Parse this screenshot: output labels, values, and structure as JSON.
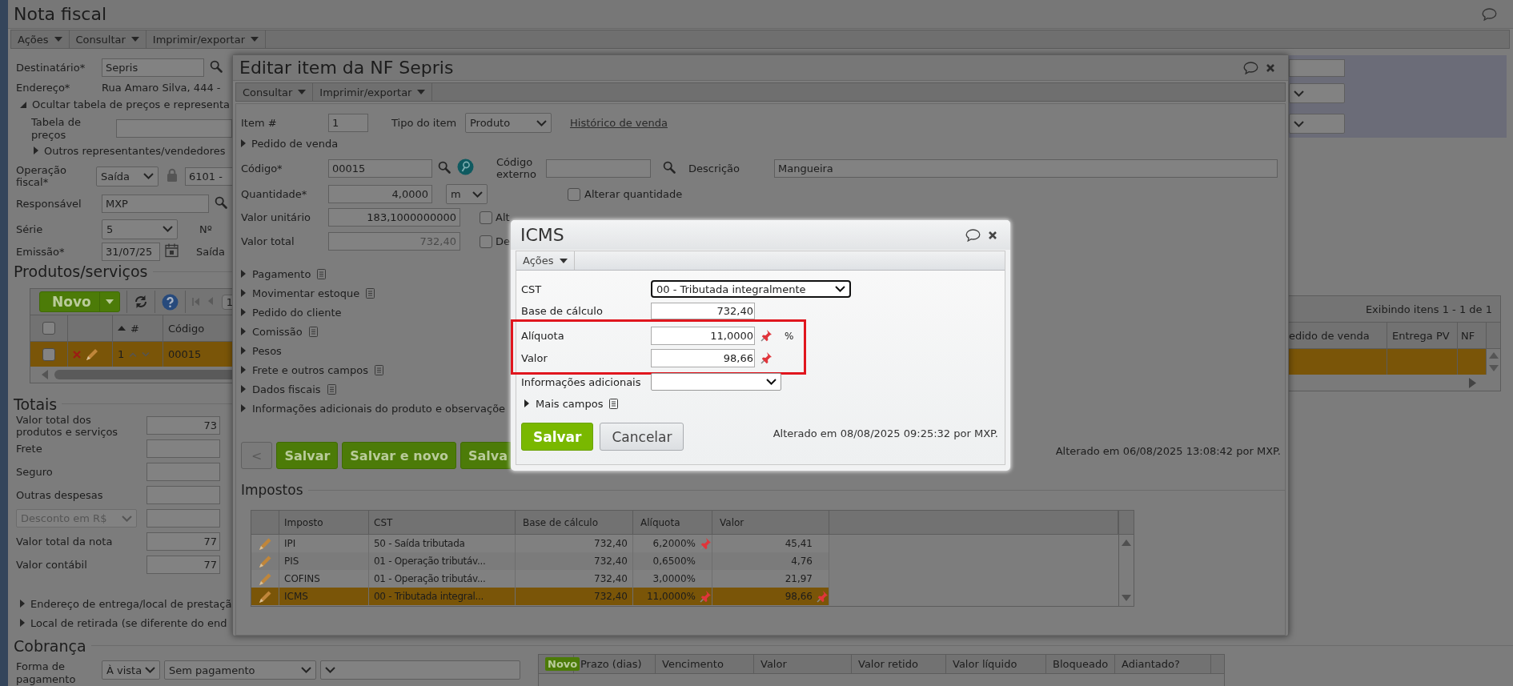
{
  "window": {
    "title": "Nota fiscal"
  },
  "menu": [
    "Ações",
    "Consultar",
    "Imprimir/exportar"
  ],
  "header": {
    "recipient": {
      "label": "Destinatário*",
      "value": "Sepris"
    },
    "address": {
      "label": "Endereço*",
      "value": "Rua Amaro Silva, 444 -"
    },
    "price_toggle": {
      "label": "Ocultar tabela de preços e representa",
      "expanded": true
    },
    "price_table": {
      "label": "Tabela de preços"
    },
    "other_reps": {
      "label": "Outros representantes/vendedores",
      "expanded": false
    },
    "operation": {
      "label": "Operação fiscal*",
      "direction": "Saída",
      "cfop": "6101 -"
    },
    "responsible": {
      "label": "Responsável",
      "value": "MXP"
    },
    "series": {
      "label": "Série",
      "value": "5",
      "number_label": "Nº"
    },
    "issue": {
      "label": "Emissão*",
      "value": "31/07/25",
      "exit_label": "Saída"
    }
  },
  "products": {
    "title": "Produtos/serviços",
    "new_button": "Novo",
    "page": "1",
    "summary": "Exibindo itens 1 - 1 de 1",
    "left_columns": [
      {
        "label": "#",
        "sorted": true
      },
      {
        "label": "Código",
        "sorted": false
      }
    ],
    "right_columns": [
      "edido de venda",
      "Entrega PV",
      "NF"
    ],
    "header_checked": false,
    "rows": [
      {
        "number": "1",
        "code": "00015",
        "selected": true,
        "checked": false
      }
    ]
  },
  "totals": {
    "title": "Totais",
    "fields": [
      {
        "kind": "field",
        "label": "Valor total dos produtos e serviços",
        "value": "73"
      },
      {
        "kind": "field",
        "label": "Frete"
      },
      {
        "kind": "field",
        "label": "Seguro"
      },
      {
        "kind": "field",
        "label": "Outras despesas"
      },
      {
        "kind": "select",
        "label": "Desconto em R$",
        "disabled": true
      },
      {
        "kind": "field",
        "label": "Valor total da nota",
        "value": "77"
      },
      {
        "kind": "field",
        "label": "Valor contábil",
        "value": "77"
      }
    ]
  },
  "sections": [
    {
      "label": "Endereço de entrega/local de prestaçã",
      "expanded": false
    },
    {
      "label": "Local de retirada (se diferente do end",
      "expanded": false
    }
  ],
  "billing": {
    "title": "Cobrança",
    "label": "Forma de pagamento",
    "selects": [
      "À vista",
      "Sem pagamento"
    ],
    "new_button": "Novo",
    "columns": [
      "Prazo (dias)",
      "Vencimento",
      "Valor",
      "Valor retido",
      "Valor líquido",
      "Bloqueado",
      "Adiantado?"
    ]
  },
  "item_dialog": {
    "title": "Editar item da NF Sepris",
    "menu": [
      "Consultar",
      "Imprimir/exportar"
    ],
    "item_number": {
      "label": "Item #",
      "value": "1"
    },
    "item_type": {
      "label": "Tipo do item",
      "value": "Produto"
    },
    "history_link": "Histórico de venda",
    "sales_order": {
      "label": "Pedido de venda",
      "expanded": false
    },
    "code": {
      "label": "Código*",
      "value": "00015"
    },
    "external_code": {
      "label": "Código externo"
    },
    "description": {
      "label": "Descrição",
      "value": "Mangueira"
    },
    "quantity": {
      "label": "Quantidade*",
      "value": "4,0000",
      "unit": "m"
    },
    "change_quantity": {
      "label": "Alterar quantidade",
      "checked": false
    },
    "unit_price": {
      "label": "Valor unitário",
      "value": "183,1000000000"
    },
    "change_unit_price": {
      "label": "Alt",
      "checked": false
    },
    "total": {
      "label": "Valor total",
      "value": "732,40",
      "disabled": true
    },
    "total_check": {
      "label": "De",
      "checked": false
    },
    "sections": [
      {
        "label": "Pagamento",
        "note": true,
        "expanded": false
      },
      {
        "label": "Movimentar estoque",
        "note": true,
        "expanded": false
      },
      {
        "label": "Pedido do cliente",
        "note": false,
        "expanded": false
      },
      {
        "label": "Comissão",
        "note": true,
        "expanded": false
      },
      {
        "label": "Pesos",
        "note": false,
        "expanded": false
      },
      {
        "label": "Frete e outros campos",
        "note": true,
        "expanded": false
      },
      {
        "label": "Dados fiscais",
        "note": true,
        "expanded": false
      },
      {
        "label": "Informações adicionais do produto e observaçõe",
        "note": false,
        "expanded": false
      }
    ],
    "buttons": [
      {
        "kind": "back",
        "label": "<"
      },
      {
        "kind": "primary",
        "label": "Salvar"
      },
      {
        "kind": "primary",
        "label": "Salvar e novo"
      },
      {
        "kind": "primary",
        "label": "Salva"
      }
    ],
    "modified": "Alterado em 06/08/2025 13:08:42 por MXP.",
    "taxes": {
      "title": "Impostos",
      "columns": [
        "Imposto",
        "CST",
        "Base de cálculo",
        "Alíquota",
        "Valor"
      ],
      "rows": [
        {
          "tax": "IPI",
          "cst": "50 - Saída tributada",
          "base": "732,40",
          "rate": "6,2000%",
          "rate_pinned": true,
          "value": "45,41",
          "value_pinned": false,
          "selected": false
        },
        {
          "tax": "PIS",
          "cst": "01 - Operação tributáv...",
          "base": "732,40",
          "rate": "0,6500%",
          "rate_pinned": false,
          "value": "4,76",
          "value_pinned": false,
          "selected": false
        },
        {
          "tax": "COFINS",
          "cst": "01 - Operação tributáv...",
          "base": "732,40",
          "rate": "3,0000%",
          "rate_pinned": false,
          "value": "21,97",
          "value_pinned": false,
          "selected": false
        },
        {
          "tax": "ICMS",
          "cst": "00 - Tributada integral...",
          "base": "732,40",
          "rate": "11,0000%",
          "rate_pinned": true,
          "value": "98,66",
          "value_pinned": true,
          "selected": true
        }
      ]
    }
  },
  "icms_dialog": {
    "title": "ICMS",
    "menu": [
      "Ações"
    ],
    "fields": [
      {
        "kind": "select",
        "label": "CST",
        "value": "00 - Tributada integralmente",
        "focused": true,
        "highlighted": false
      },
      {
        "kind": "number",
        "label": "Base de cálculo",
        "value": "732,40",
        "pinned": false,
        "highlighted": false
      },
      {
        "kind": "number",
        "label": "Alíquota",
        "value": "11,0000",
        "pinned": true,
        "unit": "%",
        "highlighted": true
      },
      {
        "kind": "number",
        "label": "Valor",
        "value": "98,66",
        "pinned": true,
        "highlighted": true
      },
      {
        "kind": "select",
        "label": "Informações adicionais",
        "focused": false,
        "highlighted": false
      }
    ],
    "more": {
      "label": "Mais campos",
      "expanded": false
    },
    "buttons": [
      {
        "kind": "primary",
        "label": "Salvar"
      },
      {
        "kind": "secondary",
        "label": "Cancelar"
      }
    ],
    "modified": "Alterado em 08/08/2025 09:25:32 por MXP."
  }
}
